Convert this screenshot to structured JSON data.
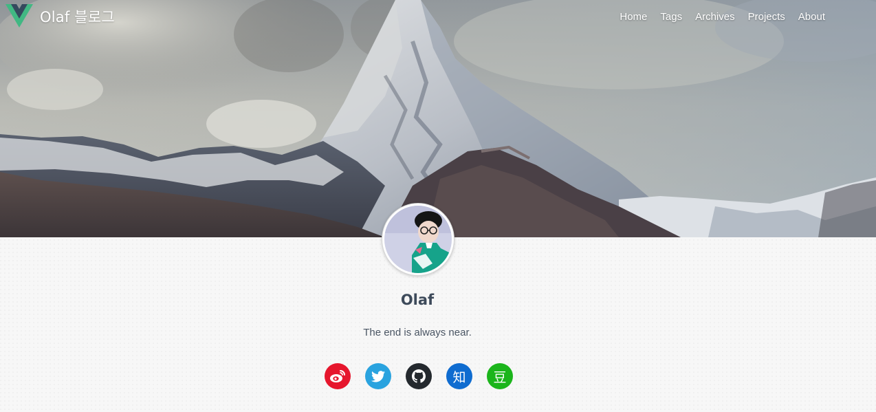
{
  "brand": {
    "title": "Olaf 블로그",
    "logo_icon": "vue-logo-icon",
    "logo_colors": {
      "outer": "#41b883",
      "inner": "#35495e"
    }
  },
  "nav": {
    "items": [
      {
        "label": "Home"
      },
      {
        "label": "Tags"
      },
      {
        "label": "Archives"
      },
      {
        "label": "Projects"
      },
      {
        "label": "About"
      }
    ]
  },
  "hero": {
    "image": "snowy-mountain-peak-photo"
  },
  "profile": {
    "avatar": "profile-avatar-photo",
    "name": "Olaf",
    "tagline": "The end is always near."
  },
  "social": {
    "links": [
      {
        "icon": "weibo-icon",
        "color": "#e6162d"
      },
      {
        "icon": "twitter-icon",
        "color": "#2aa3df"
      },
      {
        "icon": "github-icon",
        "color": "#24292e"
      },
      {
        "icon": "zhihu-icon",
        "color": "#0f6cd0",
        "glyph": "知"
      },
      {
        "icon": "douban-icon",
        "color": "#1cb51c",
        "glyph": "豆"
      }
    ]
  }
}
